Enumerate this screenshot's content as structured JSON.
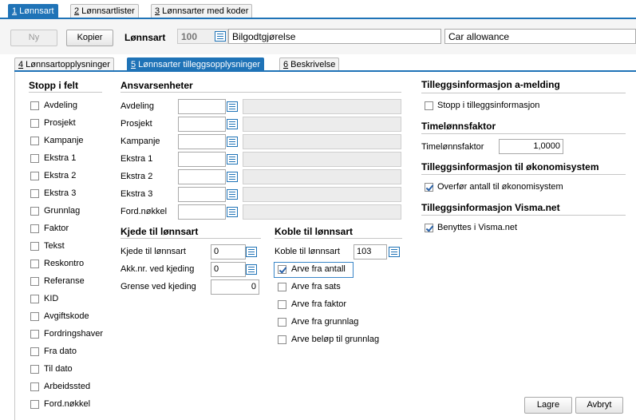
{
  "top_tabs": [
    {
      "num": "1",
      "label": " Lønnsart"
    },
    {
      "num": "2",
      "label": " Lønnsartlister"
    },
    {
      "num": "3",
      "label": " Lønnsarter med koder"
    }
  ],
  "header": {
    "ny_label": "Ny",
    "kopier_label": "Kopier",
    "lonnsart_label": "Lønnsart",
    "lonnsart_number": "100",
    "name_value": "Bilgodtgjørelse",
    "english_value": "Car allowance"
  },
  "sub_tabs": [
    {
      "num": "4",
      "label": " Lønnsartopplysninger"
    },
    {
      "num": "5",
      "label": " Lønnsarter tilleggsopplysninger"
    },
    {
      "num": "6",
      "label": " Beskrivelse"
    }
  ],
  "stopp": {
    "title": "Stopp i felt",
    "items": [
      "Avdeling",
      "Prosjekt",
      "Kampanje",
      "Ekstra 1",
      "Ekstra 2",
      "Ekstra 3",
      "Grunnlag",
      "Faktor",
      "Tekst",
      "Reskontro",
      "Referanse",
      "KID",
      "Avgiftskode",
      "Fordringshaver",
      "Fra dato",
      "Til dato",
      "Arbeidssted",
      "Ford.nøkkel"
    ]
  },
  "ansvar": {
    "title": "Ansvarsenheter",
    "items": [
      "Avdeling",
      "Prosjekt",
      "Kampanje",
      "Ekstra 1",
      "Ekstra 2",
      "Ekstra 3",
      "Ford.nøkkel"
    ]
  },
  "kjede": {
    "title": "Kjede til lønnsart",
    "kjede_label": "Kjede til lønnsart",
    "kjede_value": "0",
    "akk_label": "Akk.nr. ved kjeding",
    "akk_value": "0",
    "grense_label": "Grense ved kjeding",
    "grense_value": "0"
  },
  "koble": {
    "title": "Koble til lønnsart",
    "koble_label": "Koble til lønnsart",
    "koble_value": "103",
    "options": [
      {
        "label": "Arve fra antall",
        "checked": true
      },
      {
        "label": "Arve fra sats",
        "checked": false
      },
      {
        "label": "Arve fra faktor",
        "checked": false
      },
      {
        "label": "Arve fra grunnlag",
        "checked": false
      },
      {
        "label": "Arve beløp til grunnlag",
        "checked": false
      }
    ]
  },
  "right": {
    "amelding_title": "Tilleggsinformasjon a-melding",
    "stopp_label": "Stopp i tilleggsinformasjon",
    "stopp_checked": false,
    "timelonn_title": "Timelønnsfaktor",
    "timelonn_label": "Timelønnsfaktor",
    "timelonn_value": "1,0000",
    "okonomi_title": "Tilleggsinformasjon til økonomisystem",
    "overfor_label": "Overfør antall til økonomisystem",
    "overfor_checked": true,
    "visma_title": "Tilleggsinformasjon Visma.net",
    "benyttes_label": "Benyttes i Visma.net",
    "benyttes_checked": true
  },
  "footer": {
    "lagre_label": "Lagre",
    "avbryt_label": "Avbryt"
  },
  "colors": {
    "accent": "#1f73b7",
    "field_border": "#a9a9a9",
    "disabled_field": "#ececec"
  }
}
